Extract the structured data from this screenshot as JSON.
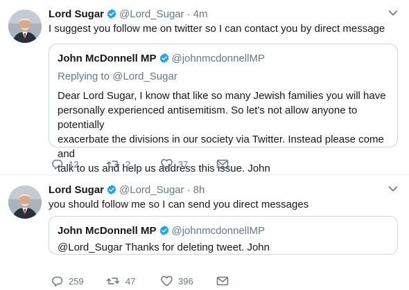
{
  "colors": {
    "accent": "#1da1f2",
    "muted": "#657786",
    "text": "#14171a",
    "border": "#ccd6dd",
    "divider": "#e6ecf0"
  },
  "tweets": [
    {
      "author": {
        "name": "Lord Sugar",
        "handle": "@Lord_Sugar",
        "verified": true,
        "avatar_icon": "avatar-photo"
      },
      "separator": "·",
      "time": "4m",
      "text": "I suggest you follow me on twitter so I can contact you by direct message",
      "quoted": {
        "author": {
          "name": "John McDonnell MP",
          "handle": "@johnmcdonnellMP",
          "verified": true
        },
        "reply_to": "Replying to @Lord_Sugar",
        "text_lines": [
          "Dear Lord Sugar, I know that like so many Jewish families you will have",
          "personally experienced antisemitism. So let's not allow anyone to  potentially",
          "exacerbate the divisions in our society via Twitter. Instead please come and",
          "talk to us and help us address this issue. John"
        ]
      },
      "actions": {
        "replies": "12",
        "retweets": "2",
        "likes": "37"
      }
    },
    {
      "author": {
        "name": "Lord Sugar",
        "handle": "@Lord_Sugar",
        "verified": true,
        "avatar_icon": "avatar-photo"
      },
      "separator": "·",
      "time": "8h",
      "text": "you should follow me so I can send you direct messages",
      "quoted": {
        "author": {
          "name": "John McDonnell MP",
          "handle": "@johnmcdonnellMP",
          "verified": true
        },
        "text": "@Lord_Sugar Thanks for deleting tweet. John"
      },
      "actions": {
        "replies": "259",
        "retweets": "47",
        "likes": "396"
      }
    }
  ]
}
